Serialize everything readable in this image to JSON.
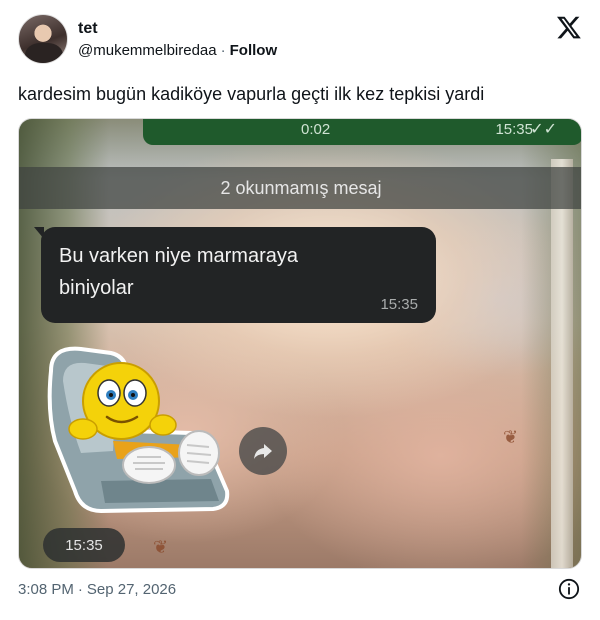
{
  "author": {
    "name": "tet",
    "handle": "@mukemmelbiredaa",
    "separator": "·",
    "follow_label": "Follow"
  },
  "tweet": {
    "text": "kardesim bugün kadiköye vapurla geçti ilk kez tepkisi yardi",
    "time": "3:08 PM",
    "separator": "·",
    "date": "Sep 27, 2026"
  },
  "chat": {
    "voice_duration": "0:02",
    "voice_time": "15:35",
    "voice_ticks": "✓✓",
    "unread_banner": "2 okunmamış mesaj",
    "message_text": "Bu varken niye marmaraya biniyolar",
    "message_time": "15:35",
    "sticker_time": "15:35"
  },
  "icons": {
    "logo": "x-logo-icon",
    "forward": "forward-arrow-icon",
    "info": "info-icon",
    "sticker": "emoji-recliner-sticker"
  },
  "colors": {
    "text_primary": "#0f1419",
    "text_secondary": "#536471",
    "bubble_incoming": "#222425",
    "bubble_outgoing": "#1f5a2c"
  }
}
